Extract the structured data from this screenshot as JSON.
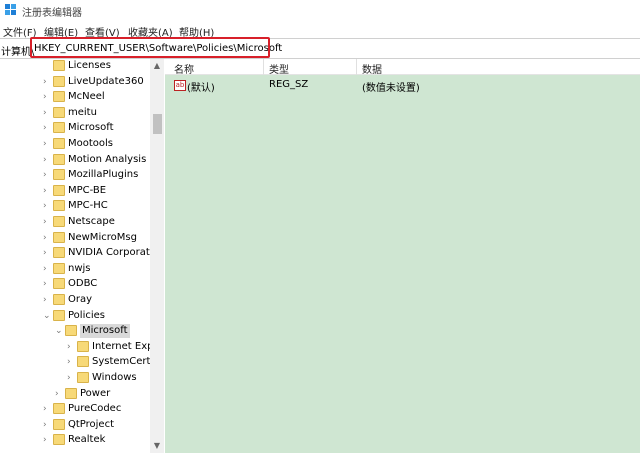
{
  "window": {
    "title": "注册表编辑器"
  },
  "menu": [
    "文件(F)",
    "编辑(E)",
    "查看(V)",
    "收藏夹(A)",
    "帮助(H)"
  ],
  "address": {
    "label": "计算机\\",
    "path": "HKEY_CURRENT_USER\\Software\\Policies\\Microsoft"
  },
  "tree": [
    {
      "label": "Licenses",
      "expandable": false
    },
    {
      "label": "LiveUpdate360",
      "expandable": true
    },
    {
      "label": "McNeel",
      "expandable": true
    },
    {
      "label": "meitu",
      "expandable": true
    },
    {
      "label": "Microsoft",
      "expandable": true
    },
    {
      "label": "Mootools",
      "expandable": true
    },
    {
      "label": "Motion Analysis",
      "expandable": true
    },
    {
      "label": "MozillaPlugins",
      "expandable": true
    },
    {
      "label": "MPC-BE",
      "expandable": true
    },
    {
      "label": "MPC-HC",
      "expandable": true
    },
    {
      "label": "Netscape",
      "expandable": true
    },
    {
      "label": "NewMicroMsg",
      "expandable": true
    },
    {
      "label": "NVIDIA Corporatio",
      "expandable": true
    },
    {
      "label": "nwjs",
      "expandable": true
    },
    {
      "label": "ODBC",
      "expandable": true
    },
    {
      "label": "Oray",
      "expandable": true
    },
    {
      "label": "Policies",
      "expandable": true,
      "expanded": true
    },
    {
      "label": "Microsoft",
      "expandable": true,
      "expanded": true,
      "selected": true
    },
    {
      "label": "Internet Explo",
      "expandable": true
    },
    {
      "label": "SystemCertifi",
      "expandable": true
    },
    {
      "label": "Windows",
      "expandable": true
    },
    {
      "label": "Power",
      "expandable": true
    },
    {
      "label": "PureCodec",
      "expandable": true
    },
    {
      "label": "QtProject",
      "expandable": true
    },
    {
      "label": "Realtek",
      "expandable": true
    }
  ],
  "columns": {
    "name": "名称",
    "type": "类型",
    "data": "数据"
  },
  "values": [
    {
      "icon": "ab",
      "name": "(默认)",
      "type": "REG_SZ",
      "data": "(数值未设置)"
    }
  ]
}
